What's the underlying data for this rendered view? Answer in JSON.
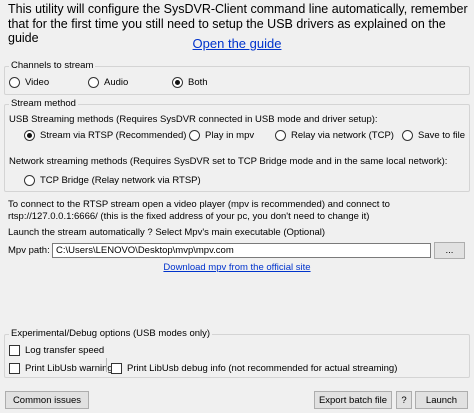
{
  "intro": {
    "text": "This utility will configure the SysDVR-Client command line automatically, remember that for the first time you still need to setup the USB drivers as explained on the guide",
    "guide_link": "Open the guide"
  },
  "channels": {
    "legend": "Channels to stream",
    "options": [
      {
        "label": "Video",
        "checked": false
      },
      {
        "label": "Audio",
        "checked": false
      },
      {
        "label": "Both",
        "checked": true
      }
    ]
  },
  "stream_method": {
    "legend": "Stream method",
    "usb_label": "USB Streaming methods (Requires SysDVR connected in USB mode and driver setup):",
    "usb_options": [
      {
        "label": "Stream via RTSP (Recommended)",
        "checked": true
      },
      {
        "label": "Play in mpv",
        "checked": false
      },
      {
        "label": "Relay via network (TCP)",
        "checked": false
      },
      {
        "label": "Save to file",
        "checked": false
      }
    ],
    "network_label": "Network streaming methods (Requires SysDVR set to TCP Bridge mode and in the same local network):",
    "network_options": [
      {
        "label": "TCP Bridge (Relay network via RTSP)",
        "checked": false
      }
    ]
  },
  "rtsp_notice": "To connect to the RTSP stream open a video player (mpv is recommended) and connect to rtsp://127.0.0.1:6666/ (this is the fixed address of your pc, you don't need to change it)",
  "launch": {
    "label": "Launch the stream automatically ? Select Mpv's main executable (Optional)",
    "mpv_label": "Mpv path:",
    "mpv_value": "C:\\Users\\LENOVO\\Desktop\\mvp\\mpv.com",
    "browse_label": "...",
    "download_link": "Download mpv from the official site"
  },
  "debug": {
    "legend": "Experimental/Debug options (USB modes only)",
    "options": [
      {
        "label": "Log transfer speed",
        "checked": false
      },
      {
        "label": "Print LibUsb warnings",
        "checked": false
      },
      {
        "label": "Print LibUsb debug info (not recommended for actual streaming)",
        "checked": false
      }
    ]
  },
  "footer": {
    "common_issues": "Common issues",
    "export_batch": "Export batch file",
    "help": "?",
    "launch": "Launch"
  }
}
